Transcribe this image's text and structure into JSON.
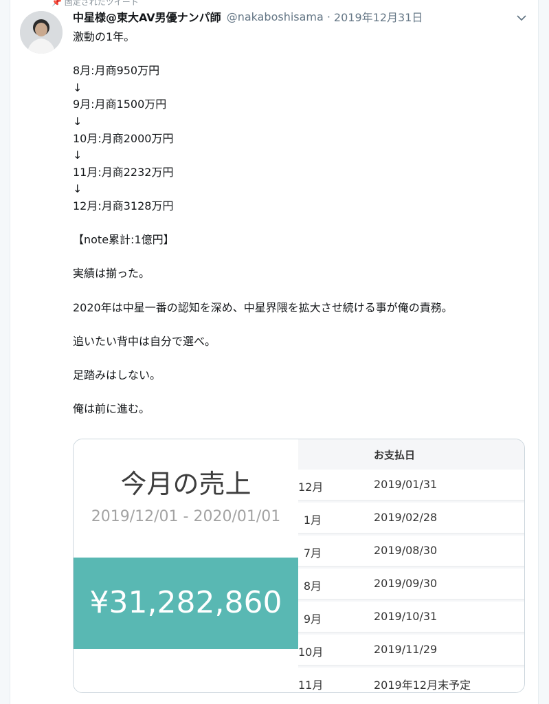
{
  "pinned_label": "固定されたツイート",
  "tweet": {
    "display_name": "中星様@東大AV男優ナンパ師",
    "handle": "@nakaboshisama",
    "separator": "·",
    "date": "2019年12月31日",
    "lines": [
      "激動の1年。",
      "",
      "8月:月商950万円",
      "↓",
      "9月:月商1500万円",
      "↓",
      "10月:月商2000万円",
      "↓",
      "11月:月商2232万円",
      "↓",
      "12月:月商3128万円",
      "",
      "【note累計:1億円】",
      "",
      "実績は揃った。",
      "",
      "2020年は中星一番の認知を深め、中星界隈を拡大させ続ける事が俺の責務。",
      "",
      "追いたい背中は自分で選べ。",
      "",
      "足踏みはしない。",
      "",
      "俺は前に進む。"
    ]
  },
  "image": {
    "sales_title": "今月の売上",
    "sales_range": "2019/12/01 - 2020/01/01",
    "sales_amount": "¥31,282,860",
    "table_header": "お支払日",
    "rows": [
      {
        "month": "12月",
        "date": "2019/01/31"
      },
      {
        "month": "1月",
        "date": "2019/02/28"
      },
      {
        "month": "7月",
        "date": "2019/08/30"
      },
      {
        "month": "8月",
        "date": "2019/09/30"
      },
      {
        "month": "9月",
        "date": "2019/10/31"
      },
      {
        "month": "10月",
        "date": "2019/11/29"
      },
      {
        "month": "11月",
        "date": "2019年12月末予定"
      }
    ]
  },
  "colors": {
    "accent_teal": "#59b8b3",
    "handle_gray": "#657786"
  },
  "icons": [
    "pin-icon",
    "avatar",
    "chevron-down-icon"
  ]
}
